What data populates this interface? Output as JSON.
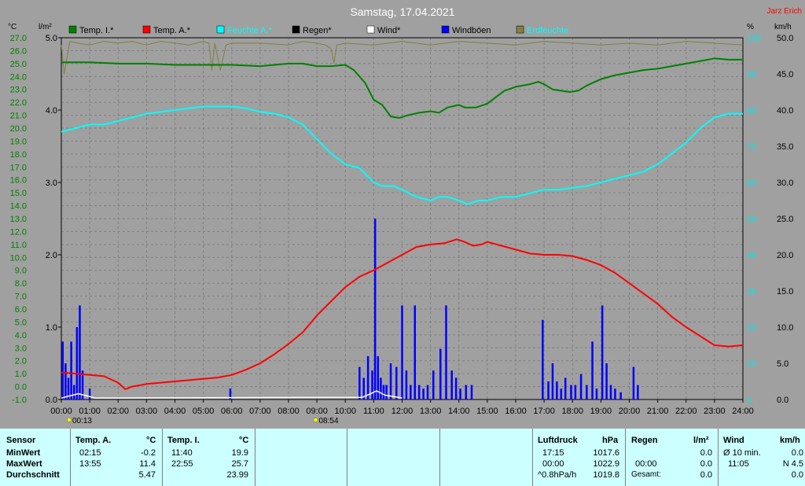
{
  "header": {
    "title": "Samstag, 17.04.2021",
    "author": "Jarz Erich"
  },
  "units": {
    "left1": "°C",
    "left2": "l/m²",
    "right1": "%",
    "right2": "km/h"
  },
  "legend": [
    {
      "label": "Temp. I.*",
      "color": "#008000"
    },
    {
      "label": "Temp. A.*",
      "color": "#ff0000"
    },
    {
      "label": "Feuchte A.*",
      "color": "#00ffff"
    },
    {
      "label": "Regen*",
      "color": "#000000"
    },
    {
      "label": "Wind*",
      "color": "#ffffff"
    },
    {
      "label": "Windböen",
      "color": "#0000ff"
    },
    {
      "label": "Erdfeuchte",
      "color": "#808040"
    }
  ],
  "annotations": [
    {
      "label": "00:13",
      "time": 0.22
    },
    {
      "label": "08:54",
      "time": 8.9
    }
  ],
  "chart_data": {
    "type": "line",
    "x_unit": "hours",
    "xlim": [
      0,
      24
    ],
    "x_ticks": [
      "00:00",
      "01:00",
      "02:00",
      "03:00",
      "04:00",
      "05:00",
      "06:00",
      "07:00",
      "08:00",
      "09:00",
      "10:00",
      "11:00",
      "12:00",
      "13:00",
      "14:00",
      "15:00",
      "16:00",
      "17:00",
      "18:00",
      "19:00",
      "20:00",
      "21:00",
      "22:00",
      "23:00",
      "24:00"
    ],
    "axes": {
      "temp": {
        "range": [
          -1,
          27
        ],
        "ticks": [
          "27.0",
          "26.0",
          "25.0",
          "24.0",
          "23.0",
          "22.0",
          "21.0",
          "20.0",
          "19.0",
          "18.0",
          "17.0",
          "16.0",
          "15.0",
          "14.0",
          "13.0",
          "12.0",
          "11.0",
          "10.0",
          "9.0",
          "8.0",
          "7.0",
          "6.0",
          "5.0",
          "4.0",
          "3.0",
          "2.0",
          "1.0",
          "0.0",
          "-1.0"
        ]
      },
      "rain": {
        "range": [
          0,
          5
        ],
        "ticks": [
          "5.0",
          "4.0",
          "3.0",
          "2.0",
          "1.0",
          "0.0"
        ]
      },
      "humidity": {
        "range": [
          0,
          100
        ],
        "ticks": [
          "100",
          "90",
          "80",
          "70",
          "60",
          "50",
          "40",
          "30",
          "20",
          "10",
          "0"
        ]
      },
      "wind": {
        "range": [
          0,
          50
        ],
        "ticks": [
          "50.0",
          "45.0",
          "40.0",
          "35.0",
          "30.0",
          "25.0",
          "20.0",
          "15.0",
          "10.0",
          "5.0",
          "0.0"
        ]
      }
    },
    "grid": true,
    "series": [
      {
        "name": "Temp. I.*",
        "axis": "temp",
        "color": "#008000",
        "x": [
          0,
          1,
          2,
          3,
          4,
          5,
          6,
          7,
          7.5,
          8,
          8.5,
          9,
          9.5,
          10,
          10.3,
          10.7,
          11,
          11.3,
          11.6,
          11.9,
          12.2,
          12.6,
          13,
          13.3,
          13.6,
          14,
          14.2,
          14.6,
          15,
          15.3,
          15.6,
          16,
          16.5,
          16.8,
          17,
          17.3,
          17.6,
          17.9,
          18.2,
          18.5,
          19,
          19.5,
          20,
          20.5,
          21,
          21.5,
          22,
          22.5,
          23,
          23.5,
          24
        ],
        "y": [
          25.1,
          25.1,
          25.0,
          25.0,
          24.9,
          24.9,
          24.9,
          24.8,
          24.9,
          25.0,
          25.0,
          24.8,
          24.8,
          24.9,
          24.5,
          23.5,
          22.2,
          21.8,
          20.9,
          20.8,
          21.0,
          21.2,
          21.3,
          21.2,
          21.6,
          21.8,
          21.6,
          21.6,
          21.9,
          22.4,
          22.9,
          23.2,
          23.4,
          23.6,
          23.4,
          23.0,
          22.9,
          22.8,
          22.9,
          23.3,
          23.8,
          24.1,
          24.3,
          24.5,
          24.6,
          24.8,
          25.0,
          25.2,
          25.4,
          25.3,
          25.3
        ]
      },
      {
        "name": "Temp. A.*",
        "axis": "temp",
        "color": "#ff0000",
        "x": [
          0,
          0.5,
          1,
          1.5,
          2,
          2.25,
          2.5,
          3,
          3.5,
          4,
          4.5,
          5,
          5.5,
          6,
          6.5,
          7,
          7.5,
          8,
          8.5,
          9,
          9.5,
          10,
          10.5,
          11,
          11.5,
          12,
          12.5,
          13,
          13.5,
          13.92,
          14.2,
          14.5,
          14.8,
          15,
          15.5,
          16,
          16.5,
          17,
          17.5,
          18,
          18.5,
          19,
          19.5,
          20,
          20.5,
          21,
          21.5,
          22,
          22.5,
          23,
          23.5,
          24
        ],
        "y": [
          1.1,
          1.0,
          0.9,
          0.8,
          0.3,
          -0.2,
          0.0,
          0.2,
          0.3,
          0.4,
          0.5,
          0.6,
          0.7,
          0.9,
          1.3,
          1.8,
          2.5,
          3.3,
          4.2,
          5.5,
          6.6,
          7.7,
          8.5,
          9.0,
          9.6,
          10.2,
          10.8,
          11.0,
          11.1,
          11.4,
          11.2,
          10.9,
          11.0,
          11.2,
          10.9,
          10.6,
          10.3,
          10.2,
          10.2,
          10.1,
          9.8,
          9.4,
          8.8,
          8.0,
          7.2,
          6.4,
          5.4,
          4.6,
          3.9,
          3.2,
          3.1,
          3.2
        ]
      },
      {
        "name": "Feuchte A.*",
        "axis": "humidity",
        "color": "#00ffff",
        "x": [
          0,
          0.5,
          1,
          1.5,
          2,
          2.5,
          3,
          4,
          5,
          6,
          6.5,
          7,
          7.5,
          8,
          8.5,
          9,
          9.5,
          10,
          10.5,
          11,
          11.3,
          11.7,
          12,
          12.5,
          13,
          13.3,
          13.6,
          14,
          14.3,
          14.7,
          15,
          15.5,
          16,
          16.5,
          17,
          17.5,
          18,
          18.5,
          19,
          19.5,
          20,
          20.5,
          21,
          21.5,
          22,
          22.5,
          23,
          23.5,
          24
        ],
        "y": [
          74,
          75,
          76,
          76,
          77,
          78,
          79,
          80,
          81,
          81,
          80.5,
          79.5,
          79,
          78,
          76,
          72,
          68,
          65,
          64,
          60,
          59,
          59,
          58,
          56,
          55,
          56,
          56,
          55,
          54,
          55,
          55,
          56,
          56,
          57,
          58,
          58,
          58.5,
          59,
          60,
          61,
          62,
          63,
          65,
          68,
          71,
          75,
          78,
          79,
          79
        ]
      },
      {
        "name": "Windböen",
        "axis": "wind",
        "color": "#0000ff",
        "type": "bar",
        "x": [
          0.05,
          0.15,
          0.25,
          0.35,
          0.45,
          0.55,
          0.65,
          0.75,
          1.0,
          5.95,
          10.5,
          10.65,
          10.8,
          10.95,
          11.05,
          11.15,
          11.25,
          11.35,
          11.45,
          11.6,
          11.8,
          12.0,
          12.15,
          12.3,
          12.45,
          12.6,
          12.75,
          12.9,
          13.1,
          13.35,
          13.55,
          13.75,
          13.9,
          14.05,
          14.25,
          14.45,
          16.95,
          17.15,
          17.3,
          17.45,
          17.6,
          17.75,
          17.95,
          18.1,
          18.3,
          18.5,
          18.7,
          18.85,
          19.05,
          19.2,
          19.35,
          19.5,
          19.7,
          20.15,
          20.3
        ],
        "y": [
          8,
          5,
          3,
          8,
          2,
          10,
          13,
          4,
          1.5,
          1.5,
          4.5,
          3,
          6,
          4,
          25,
          6,
          3,
          2,
          2,
          5,
          4.5,
          13,
          4,
          2,
          13,
          2,
          1.5,
          2,
          4,
          7,
          13,
          4,
          3,
          1.5,
          2,
          2,
          11,
          2.5,
          5,
          2.5,
          1.5,
          3,
          2,
          2,
          3.5,
          2,
          8,
          1.5,
          13,
          5,
          2,
          1.5,
          1,
          4.5,
          2
        ]
      },
      {
        "name": "Wind*",
        "axis": "wind",
        "color": "#ffffff",
        "x": [
          0,
          0.3,
          0.6,
          0.9,
          1.2,
          10.6,
          10.9,
          11.1,
          11.4,
          11.7,
          12
        ],
        "y": [
          0.2,
          0.5,
          0.8,
          0.5,
          0.2,
          0.3,
          0.8,
          1.2,
          0.6,
          0.4,
          0.2
        ]
      },
      {
        "name": "Erdfeuchte",
        "axis": "humidity",
        "color": "#808040",
        "x": [
          0,
          0.1,
          0.3,
          0.6,
          1,
          1.5,
          2,
          2.5,
          3,
          3.5,
          4,
          4.5,
          5,
          5.2,
          5.3,
          5.4,
          5.6,
          5.8,
          6,
          7,
          8,
          8.5,
          9,
          9.3,
          9.5,
          9.6,
          9.7,
          10,
          11,
          12,
          13,
          14,
          15,
          16,
          17,
          18,
          19,
          20,
          21,
          22,
          23,
          24
        ],
        "y": [
          98,
          90,
          99,
          98.5,
          98,
          99,
          98.5,
          99,
          98,
          99,
          98.5,
          98,
          99,
          98.5,
          91,
          98.5,
          91,
          98,
          98.5,
          98.5,
          98,
          99,
          98.5,
          98,
          97,
          93,
          98,
          98.5,
          98,
          99,
          98,
          99,
          98.5,
          98,
          99,
          98.5,
          98,
          98.5,
          98,
          99,
          98.5,
          98
        ]
      }
    ]
  },
  "panel": {
    "sensor": {
      "header": "Sensor",
      "rows": [
        "MinWert",
        "MaxWert",
        "Durchschnitt"
      ]
    },
    "temp_a": {
      "header": "Temp. A.",
      "unit": "°C",
      "min_time": "02:15",
      "min_val": "-0.2",
      "max_time": "13:55",
      "max_val": "11.4",
      "avg": "5.47"
    },
    "temp_i": {
      "header": "Temp. I.",
      "unit": "°C",
      "min_time": "11:40",
      "min_val": "19.9",
      "max_time": "22:55",
      "max_val": "25.7",
      "avg": "23.99"
    },
    "pressure": {
      "header": "Luftdruck",
      "unit": "hPa",
      "min_time": "17:15",
      "min_val": "1017.6",
      "max_time": "00:00",
      "max_val": "1022.9",
      "avg_label": "^0.8hPa/h",
      "avg": "1019.8"
    },
    "rain": {
      "header": "Regen",
      "unit": "l/m²",
      "min_val": "0.0",
      "max_time": "00:00",
      "max_val": "0.0",
      "avg_label": "Gesamt:",
      "avg": "0.0"
    },
    "wind": {
      "header": "Wind",
      "unit": "km/h",
      "min_label": "Ø 10 min.",
      "min_val": "0.0",
      "max_time": "11:05",
      "max_val": "N 4.5",
      "avg": "0.0"
    }
  }
}
